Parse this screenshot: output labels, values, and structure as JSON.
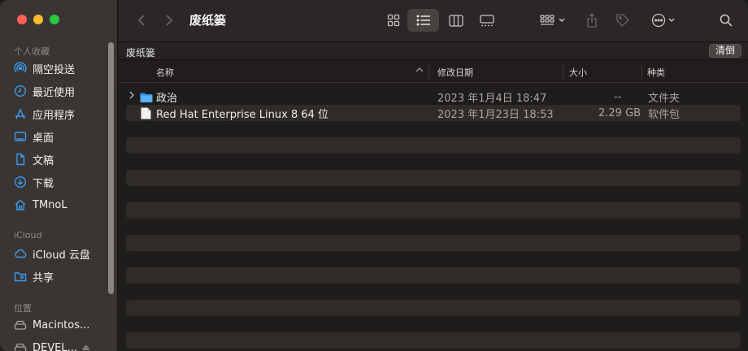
{
  "window": {
    "title": "废纸篓"
  },
  "sidebar": {
    "sections": [
      {
        "label": "个人收藏"
      },
      {
        "label": "iCloud"
      },
      {
        "label": "位置"
      }
    ],
    "favorites": [
      {
        "label": "隔空投送",
        "icon": "airdrop-icon"
      },
      {
        "label": "最近使用",
        "icon": "clock-icon"
      },
      {
        "label": "应用程序",
        "icon": "applications-icon"
      },
      {
        "label": "桌面",
        "icon": "desktop-icon"
      },
      {
        "label": "文稿",
        "icon": "document-icon"
      },
      {
        "label": "下载",
        "icon": "download-icon"
      },
      {
        "label": "TMnoL",
        "icon": "home-icon"
      }
    ],
    "icloud": [
      {
        "label": "iCloud 云盘",
        "icon": "cloud-icon"
      },
      {
        "label": "共享",
        "icon": "shared-folder-icon"
      }
    ],
    "locations": [
      {
        "label": "Macintos...",
        "icon": "disk-icon"
      },
      {
        "label": "DEVEL...",
        "icon": "disk-icon"
      }
    ]
  },
  "pathbar": {
    "label": "废纸篓",
    "clear_label": "清倒"
  },
  "columns": {
    "name": "名称",
    "modified": "修改日期",
    "size": "大小",
    "kind": "种类"
  },
  "files": [
    {
      "name": "政治",
      "modified": "2023 年1月4日 18:47",
      "size": "--",
      "kind": "文件夹",
      "type": "folder"
    },
    {
      "name": "Red Hat Enterprise Linux 8 64 位",
      "modified": "2023 年1月23日 18:53",
      "size": "2.29 GB",
      "kind": "软件包",
      "type": "file"
    }
  ],
  "colors": {
    "accent": "#3a9bf0",
    "close": "#ff5f57",
    "minimize": "#febc2e",
    "maximize": "#28c840"
  }
}
